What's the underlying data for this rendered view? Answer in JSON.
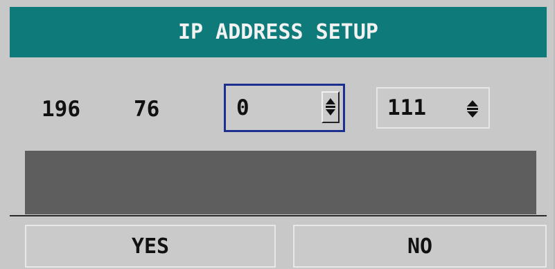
{
  "dialog": {
    "title": "IP ADDRESS SETUP"
  },
  "ip": {
    "octet1": "196",
    "octet2": "76",
    "octet3": "0",
    "octet4": "111"
  },
  "buttons": {
    "yes_label": "YES",
    "no_label": "NO"
  },
  "colors": {
    "title_bar": "#0f7a7a",
    "focus_border": "#1c2f8f",
    "message_area": "#5e5e5e",
    "background": "#c8c8c8"
  },
  "icons": {
    "spinner": "up-down-arrows-icon"
  }
}
